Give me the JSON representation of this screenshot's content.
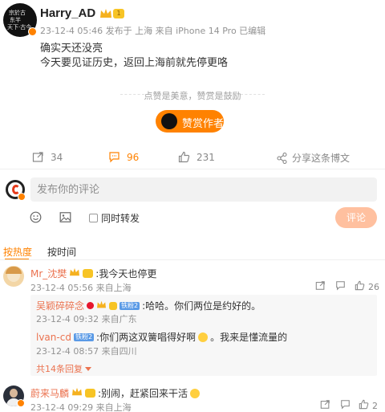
{
  "post": {
    "author": "Harry_AD",
    "level": "1",
    "meta": "23-12-4 05:46 发布于 上海 来自 iPhone 14 Pro 已编辑",
    "line1": "确实天还没亮",
    "line2": "今天要见证历史，返回上海前就先停更咯",
    "divider": "点赞是美意，赞赏是鼓励",
    "tip_label": "赞赏作者"
  },
  "actions": {
    "repost": "34",
    "comments": "96",
    "likes": "231",
    "share": "分享这条博文"
  },
  "composer": {
    "placeholder": "发布你的评论",
    "repost_label": "同时转发",
    "submit": "评论"
  },
  "tabs": {
    "hot": "按热度",
    "time": "按时间"
  },
  "comments": [
    {
      "name": "Mr_沈樊",
      "text": ":我今天也停更",
      "meta": "23-12-4 05:56 来自上海",
      "likes": "26",
      "replies": [
        {
          "name": "吴颖碎碎念",
          "tag": "铁粉2",
          "text": ":哈哈。你们两位是约好的。",
          "meta": "23-12-4 09:32 来自广东"
        },
        {
          "name": "lvan-cd",
          "tag": "铁粉2",
          "text": ":你们两这双簧唱得好啊",
          "text2": "。我来是懂流量的",
          "meta": "23-12-4 08:57 来自四川"
        }
      ],
      "more": "共14条回复"
    },
    {
      "name": "蔚来马麟",
      "text": ":别闹，赶紧回来干活",
      "meta": "23-12-4 09:29 来自上海",
      "likes": "2"
    }
  ],
  "colors": {
    "accent": "#ff8200",
    "name": "#eb7350",
    "muted": "#939393"
  }
}
